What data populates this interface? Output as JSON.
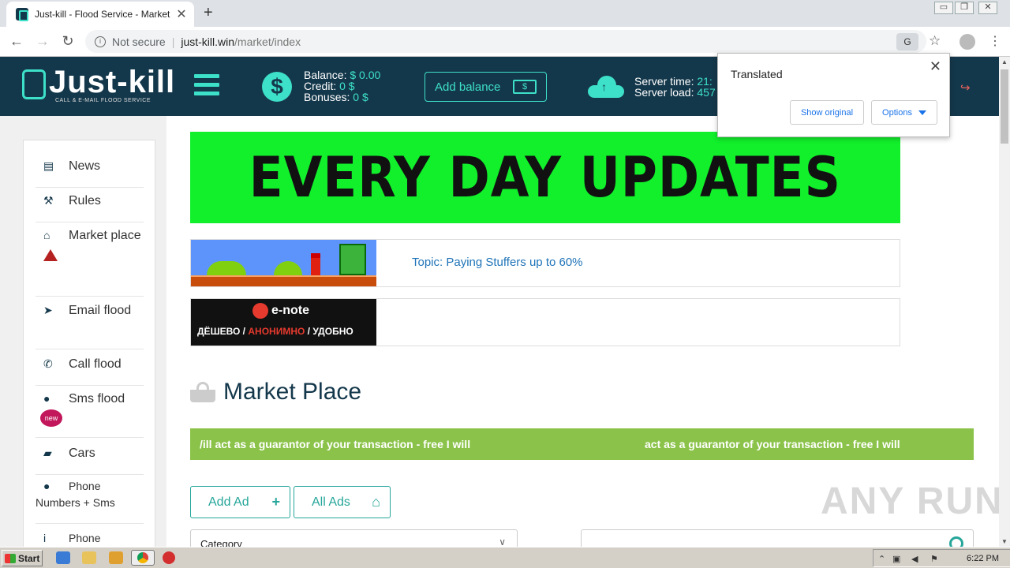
{
  "browser": {
    "tab_title": "Just-kill - Flood Service - Market",
    "tab_close": "✕",
    "new_tab": "+",
    "back": "←",
    "forward": "→",
    "reload": "↻",
    "security_label": "Not secure",
    "url_host": "just-kill.win",
    "url_path": "/market/index",
    "window_controls": [
      "▭",
      "❐",
      "✕"
    ]
  },
  "translate_popup": {
    "title": "Translated",
    "show_original": "Show original",
    "options": "Options",
    "close": "✕"
  },
  "header": {
    "logo_name": "Just-kill",
    "logo_tagline": "CALL & E-MAIL FLOOD SERVICE",
    "balance_label": "Balance:",
    "balance_value": "$ 0.00",
    "credit_label": "Credit:",
    "credit_value": "0 $",
    "bonuses_label": "Bonuses:",
    "bonuses_value": "0 $",
    "add_balance": "Add balance",
    "server_time_label": "Server time:",
    "server_time_value": "21:",
    "server_load_label": "Server load:",
    "server_load_value": "457",
    "accent_color": "#3de0c8",
    "header_bg": "#14384b"
  },
  "sidebar": {
    "items": [
      {
        "label": "News",
        "icon": "newspaper-icon"
      },
      {
        "label": "Rules",
        "icon": "gavel-icon"
      },
      {
        "label": "Market place",
        "icon": "basket-icon"
      },
      {
        "label": "Email flood",
        "icon": "paper-plane-icon"
      },
      {
        "label": "Call flood",
        "icon": "phone-icon"
      },
      {
        "label": "Sms flood",
        "icon": "chat-icon",
        "badge": "new"
      },
      {
        "label": "Cars",
        "icon": "car-icon"
      },
      {
        "label": "Phone Numbers + Sms",
        "icon": "chat-icon"
      },
      {
        "label": "Phone",
        "icon": "info-icon"
      }
    ]
  },
  "banner": {
    "text": "EVERY DAY UPDATES",
    "color": "#11f02b"
  },
  "ads": [
    {
      "topic": "Topic: Paying Stuffers up to 60%"
    },
    {
      "brand": "e-note",
      "slogan_1": "ДЁШЕВО",
      "slogan_2": "АНОНИМНО",
      "slogan_3": "УДОБНО"
    }
  ],
  "market": {
    "title": "Market Place",
    "marquee_1": "/ill act as a guarantor of your transaction - free I will",
    "marquee_2": "act as a guarantor of your transaction - free I will",
    "add_ad": "Add Ad",
    "all_ads": "All Ads",
    "category_placeholder": "Category"
  },
  "watermark": "ANY RUN",
  "taskbar": {
    "start": "Start",
    "clock": "6:22 PM"
  }
}
